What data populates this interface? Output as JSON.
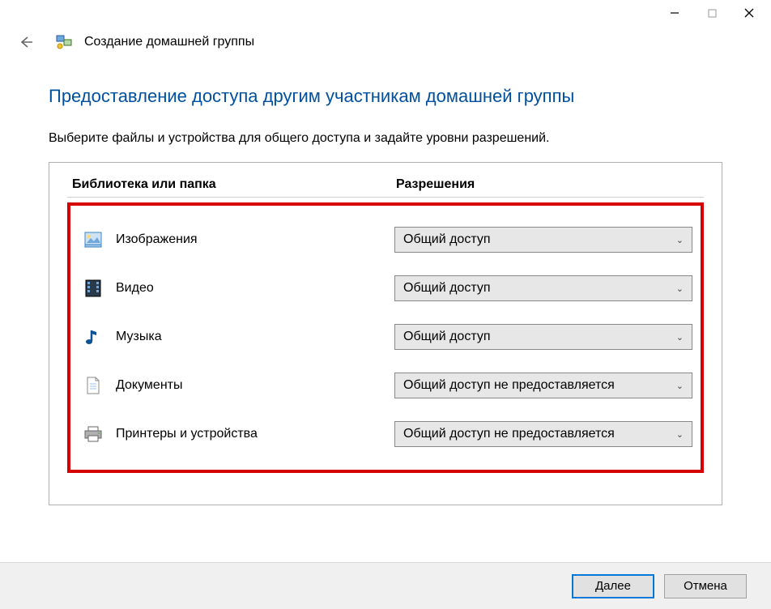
{
  "window": {
    "title": "Создание домашней группы"
  },
  "page": {
    "heading": "Предоставление доступа другим участникам домашней группы",
    "instruction": "Выберите файлы и устройства для общего доступа и задайте уровни разрешений."
  },
  "table": {
    "col_library": "Библиотека или папка",
    "col_permission": "Разрешения"
  },
  "rows": [
    {
      "icon": "pictures-icon",
      "label": "Изображения",
      "permission": "Общий доступ"
    },
    {
      "icon": "video-icon",
      "label": "Видео",
      "permission": "Общий доступ"
    },
    {
      "icon": "music-icon",
      "label": "Музыка",
      "permission": "Общий доступ"
    },
    {
      "icon": "documents-icon",
      "label": "Документы",
      "permission": "Общий доступ не предоставляется"
    },
    {
      "icon": "printers-icon",
      "label": "Принтеры и устройства",
      "permission": "Общий доступ не предоставляется"
    }
  ],
  "buttons": {
    "next": "Далее",
    "cancel": "Отмена"
  }
}
